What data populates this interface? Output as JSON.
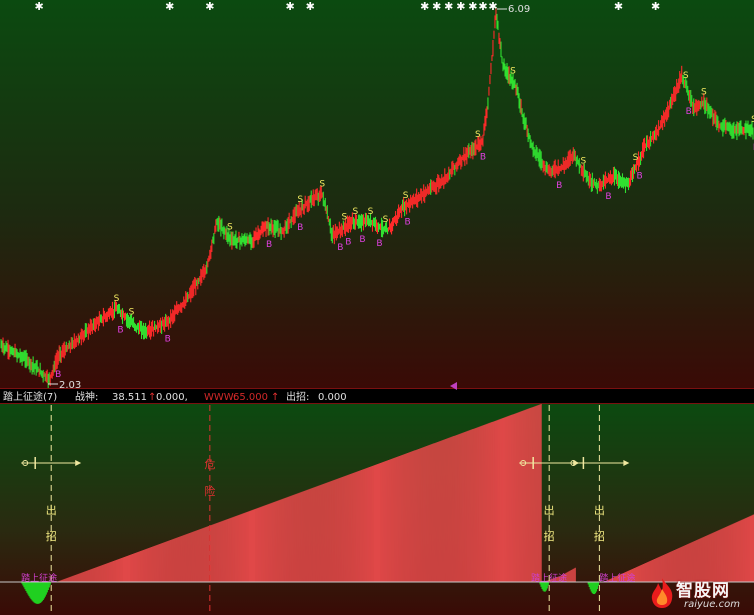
{
  "chart_data": [
    {
      "type": "candlestick",
      "panel": "price",
      "markers": {
        "high_label": "6.09",
        "low_label": "2.03",
        "sell_glyph": "S",
        "buy_glyph": "B",
        "top_glyph": "✱"
      },
      "n_bars": 750,
      "price_anchors": [
        [
          0,
          2.45
        ],
        [
          25,
          2.3
        ],
        [
          48,
          2.08
        ],
        [
          58,
          2.35
        ],
        [
          75,
          2.5
        ],
        [
          95,
          2.7
        ],
        [
          115,
          2.85
        ],
        [
          135,
          2.65
        ],
        [
          145,
          2.6
        ],
        [
          165,
          2.7
        ],
        [
          185,
          2.95
        ],
        [
          205,
          3.3
        ],
        [
          215,
          3.8
        ],
        [
          230,
          3.6
        ],
        [
          250,
          3.6
        ],
        [
          265,
          3.75
        ],
        [
          280,
          3.7
        ],
        [
          295,
          3.9
        ],
        [
          310,
          4.05
        ],
        [
          320,
          4.1
        ],
        [
          330,
          3.65
        ],
        [
          350,
          3.8
        ],
        [
          370,
          3.8
        ],
        [
          385,
          3.7
        ],
        [
          400,
          3.95
        ],
        [
          420,
          4.1
        ],
        [
          440,
          4.25
        ],
        [
          460,
          4.5
        ],
        [
          472,
          4.6
        ],
        [
          480,
          4.7
        ],
        [
          486,
          5.2
        ],
        [
          493,
          6.09
        ],
        [
          500,
          5.5
        ],
        [
          512,
          5.3
        ],
        [
          520,
          4.95
        ],
        [
          530,
          4.6
        ],
        [
          545,
          4.35
        ],
        [
          560,
          4.4
        ],
        [
          570,
          4.55
        ],
        [
          585,
          4.25
        ],
        [
          595,
          4.2
        ],
        [
          610,
          4.3
        ],
        [
          625,
          4.2
        ],
        [
          640,
          4.6
        ],
        [
          655,
          4.8
        ],
        [
          668,
          5.1
        ],
        [
          678,
          5.4
        ],
        [
          690,
          5.05
        ],
        [
          700,
          5.1
        ],
        [
          715,
          4.85
        ],
        [
          730,
          4.8
        ],
        [
          745,
          4.8
        ]
      ],
      "signals": {
        "sell_x": [
          115,
          130,
          228,
          298,
          320,
          342,
          353,
          368,
          383,
          403,
          475,
          510,
          580,
          632,
          682,
          700,
          750
        ],
        "buy_x": [
          57,
          119,
          166,
          267,
          298,
          338,
          346,
          360,
          377,
          405,
          480,
          556,
          605,
          636,
          685,
          752
        ],
        "top_x": [
          38,
          168,
          208,
          288,
          308,
          422,
          434,
          446,
          458,
          470,
          480,
          490,
          615,
          652
        ]
      }
    },
    {
      "type": "bar",
      "panel": "indicator",
      "legend": {
        "title": "踏上征途(7)",
        "s1_label": "战神:",
        "s1_value": "38.511",
        "s2_value": "0.000,",
        "s3_label": "WWW:",
        "s3_value": "65.000",
        "s4_label": "出招:",
        "s4_value": "0.000"
      },
      "ylim": [
        0,
        100
      ],
      "n_bars": 750,
      "ramp_segments": [
        [
          55,
          538,
          0,
          100
        ],
        [
          540,
          555,
          0,
          3
        ],
        [
          556,
          572,
          3,
          8
        ],
        [
          600,
          750,
          0,
          38
        ]
      ],
      "negative_dips": [
        [
          20,
          50,
          9
        ],
        [
          536,
          546,
          4
        ],
        [
          584,
          596,
          5
        ]
      ],
      "annotations": {
        "chu_zhao_x": [
          50,
          546,
          596
        ],
        "danger_x": 208,
        "chu_zhao_text": [
          "出",
          "招"
        ],
        "danger_text": [
          "危",
          "险"
        ],
        "name_text": "踏上征途",
        "sword_x": [
          50,
          546,
          596
        ]
      }
    }
  ],
  "brand": {
    "name": "智股网",
    "url": "raiyue.com"
  }
}
